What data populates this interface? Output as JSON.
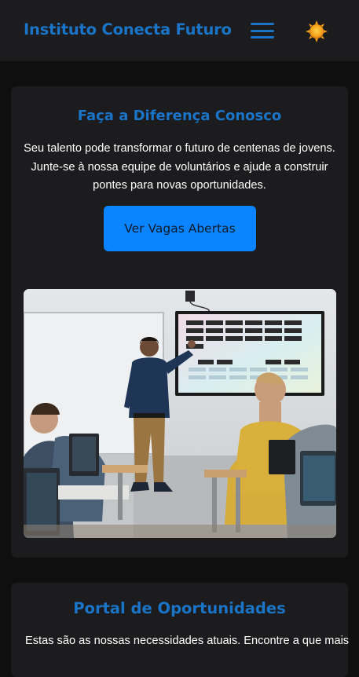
{
  "header": {
    "brand": "Instituto Conecta Futuro",
    "menu_icon": "hamburger-menu-icon",
    "theme_icon": "sun-icon",
    "colors": {
      "brand": "#1a74c7",
      "background": "#1c1c1e"
    }
  },
  "volunteer": {
    "title": "Faça a Diferença Conosco",
    "text": "Seu talento pode transformar o futuro de centenas de jovens. Junte-se à nossa equipe de voluntários e ajude a construir pontes para novas oportunidades.",
    "cta_label": "Ver Vagas Abertas",
    "colors": {
      "cta": "#0a84ff"
    }
  },
  "portal": {
    "title": "Portal de Oportunidades",
    "text": "Estas são as nossas necessidades atuais. Encontre a que mais"
  }
}
